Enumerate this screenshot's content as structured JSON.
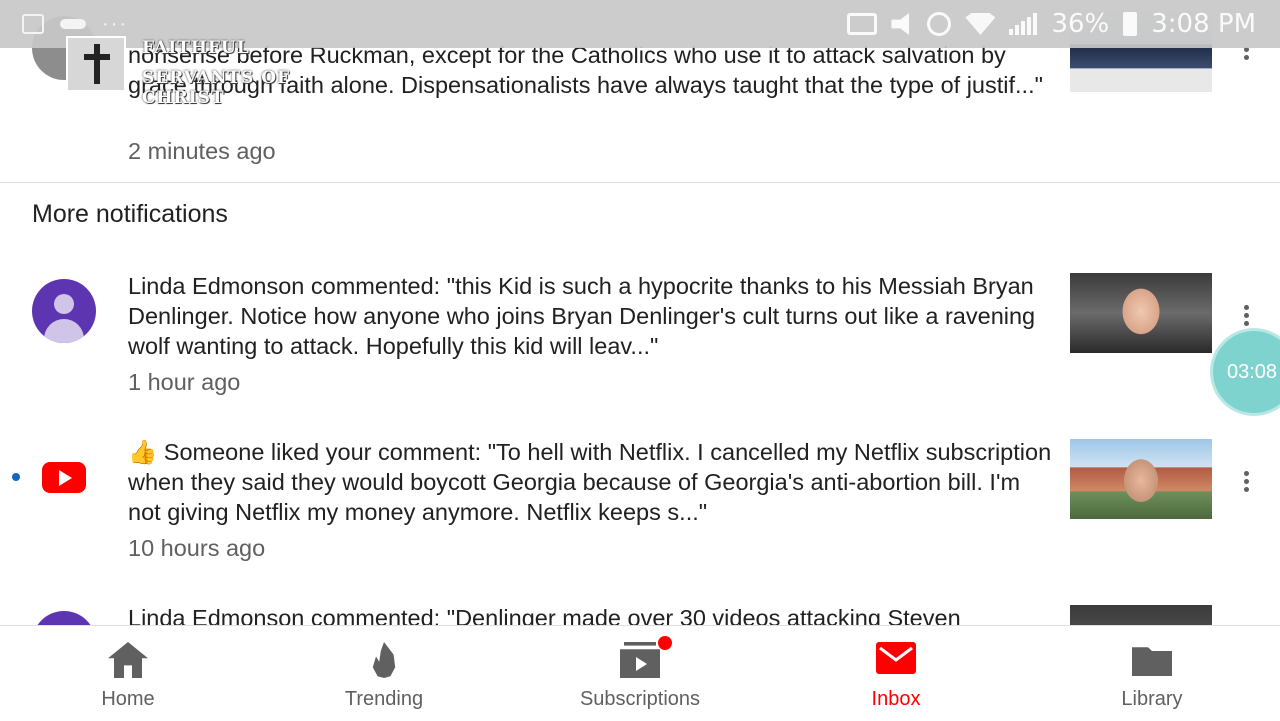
{
  "status_bar": {
    "battery": "36%",
    "time": "3:08 PM"
  },
  "watermark": {
    "line1": "FAITHFUL",
    "line2": "SERVANTS OF CHRIST"
  },
  "notifications_top": {
    "text": "nonsense before Ruckman, except for the Catholics who use it to attack salvation by grace through faith alone. Dispensationalists have always taught that the type of justif...\"",
    "time": "2 minutes ago"
  },
  "section": {
    "title": "More notifications"
  },
  "notifications": [
    {
      "text": "Linda Edmonson commented: \"this Kid is such a hypocrite thanks to his Messiah Bryan Denlinger. Notice how anyone who joins Bryan Denlinger's cult turns out like a ravening wolf wanting to attack. Hopefully this kid will leav...\"",
      "time": "1 hour ago"
    },
    {
      "text": "👍 Someone liked your comment: \"To hell with Netflix. I cancelled my Netflix subscription when they said they would boycott Georgia because of Georgia's anti-abortion bill. I'm not giving Netflix my money anymore. Netflix keeps s...\"",
      "time": "10 hours ago"
    },
    {
      "text": "Linda Edmonson commented: \"Denlinger made over 30 videos attacking Steven"
    }
  ],
  "timer": "03:08",
  "bottom_nav": [
    {
      "label": "Home",
      "icon": "home-icon"
    },
    {
      "label": "Trending",
      "icon": "trending-flame-icon"
    },
    {
      "label": "Subscriptions",
      "icon": "subscriptions-icon"
    },
    {
      "label": "Inbox",
      "icon": "inbox-icon",
      "active": true
    },
    {
      "label": "Library",
      "icon": "library-folder-icon"
    }
  ],
  "colors": {
    "accent_red": "#ff0000",
    "avatar_purple": "#5e35b1",
    "unread_dot": "#1565c0"
  }
}
